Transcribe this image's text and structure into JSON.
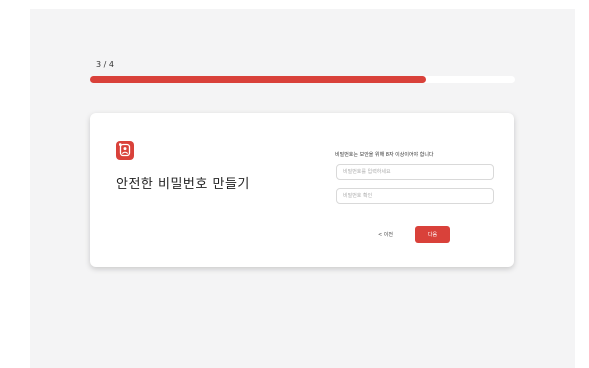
{
  "progress": {
    "step_label": "3 / 4",
    "fraction": 0.79,
    "color": "#d9413a"
  },
  "card": {
    "logo_icon": "lock-person-icon",
    "title": "안전한 비밀번호 만들기",
    "hint": "비밀번호는 보안을 위해 8자 이상이어야 합니다",
    "password_placeholder": "비밀번호를 입력하세요",
    "confirm_placeholder": "비밀번호 확인",
    "prev_label": "< 이전",
    "next_label": "다음"
  }
}
